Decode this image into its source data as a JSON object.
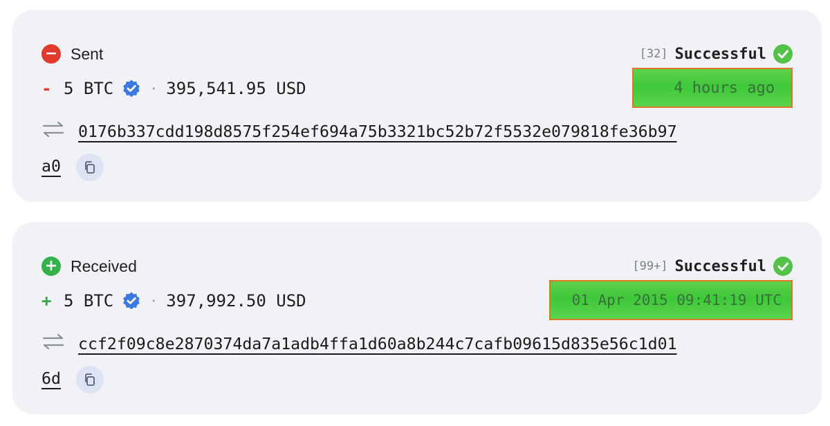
{
  "transactions": [
    {
      "direction_label": "Sent",
      "direction_icon": "minus-circle-icon",
      "confirmations": "[32]",
      "status": "Successful",
      "sign": "-",
      "amount": "5 BTC",
      "separator": "·",
      "usd_value": "395,541.95 USD",
      "time": "4 hours ago",
      "hash_line1": "0176b337cdd198d8575f254ef694a75b3321bc52b72f5532e079818fe36b97",
      "hash_line2": "a0"
    },
    {
      "direction_label": "Received",
      "direction_icon": "plus-circle-icon",
      "confirmations": "[99+]",
      "status": "Successful",
      "sign": "+",
      "amount": "5 BTC",
      "separator": "·",
      "usd_value": "397,992.50 USD",
      "time": "01 Apr 2015 09:41:19 UTC",
      "hash_line1": "ccf2f09c8e2870374da7a1adb4ffa1d60a8b244c7cafb09615d835e56c1d01",
      "hash_line2": "6d"
    }
  ],
  "colors": {
    "sent": "#e03a2e",
    "received": "#34b24a",
    "success": "#55c04a",
    "verified": "#3b78e0",
    "highlight": "#3ec83a",
    "highlight_border": "#e07624",
    "card_bg": "#f1f2f6"
  }
}
